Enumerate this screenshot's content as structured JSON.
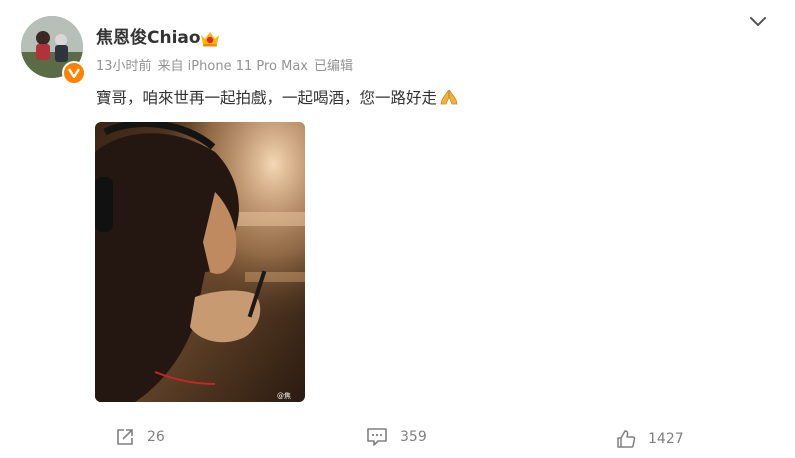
{
  "post": {
    "username": "焦恩俊Chiao",
    "time": "13小时前",
    "source": "来自 iPhone 11 Pro Max",
    "edited": "已编辑",
    "text": "寶哥，咱來世再一起拍戲，一起喝酒，您一路好走",
    "image_watermark": "@焦"
  },
  "icons": {
    "verified": "verified-v-icon",
    "member": "crown-icon",
    "menu": "chevron-down-icon",
    "emoji": "praying-hands-icon",
    "repost": "repost-icon",
    "comment": "comment-icon",
    "like": "thumbs-up-icon"
  },
  "actions": {
    "repost_count": "26",
    "comment_count": "359",
    "like_count": "1427"
  },
  "colors": {
    "verified": "#ff8200",
    "meta_text": "#939393",
    "action_text": "#808080"
  }
}
